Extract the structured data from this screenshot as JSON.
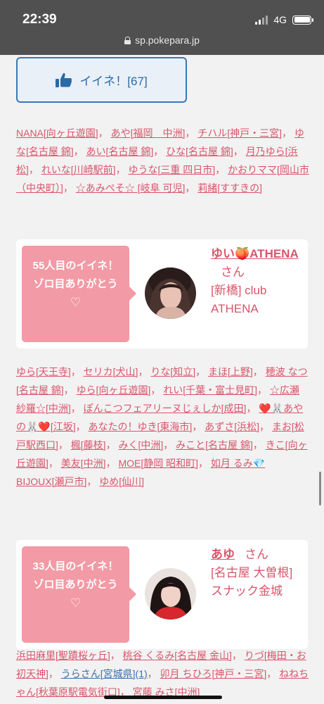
{
  "status_bar": {
    "time": "22:39",
    "network": "4G",
    "url": "sp.pokepara.jp"
  },
  "like_button": {
    "label": "イイネ！[67]"
  },
  "list1": [
    {
      "text": "NANA[向ヶ丘遊園]"
    },
    {
      "text": "あや[福岡　中洲]"
    },
    {
      "text": "チハル[神戸・三宮]"
    },
    {
      "text": "ゆな[名古屋 錦]"
    },
    {
      "text": "あい[名古屋 錦]"
    },
    {
      "text": "ひな[名古屋 錦]"
    },
    {
      "text": "月乃ゆら[浜松]"
    },
    {
      "text": "れいな[川崎駅前]"
    },
    {
      "text": "ゆうな[三重 四日市]"
    },
    {
      "text": "かおりママ[岡山市（中央町）]"
    },
    {
      "text": "☆あみぺそ☆ [岐阜 可児]"
    },
    {
      "text": "莉緒[すすきの]"
    }
  ],
  "card1": {
    "bubble_line1": "55人目のイイネ！",
    "bubble_line2": "ゾロ目ありがとう",
    "bubble_heart": "♡",
    "name": "ゆい🍑ATHENA",
    "san": "さん",
    "shop": "[新橋] club ATHENA"
  },
  "list2": [
    {
      "text": "ゆら[天王寺]"
    },
    {
      "text": "セリカ[犬山]"
    },
    {
      "text": "りな[知立]"
    },
    {
      "text": "まほ[上野]"
    },
    {
      "text": "穂波 なつ[名古屋 錦]"
    },
    {
      "text": "ゆら[向ヶ丘遊園]"
    },
    {
      "text": "れい[千葉・富士見町]"
    },
    {
      "text": "☆広瀬 紗羅☆[中洲]"
    },
    {
      "text": "ぽんこつフェアリーヌじぇしか[成田]"
    },
    {
      "text": "❤️🐰あやの🐰❤️[江坂]"
    },
    {
      "text": "あなたの！ゆき[東海市]"
    },
    {
      "text": "あずさ[浜松]"
    },
    {
      "text": "まお[松戸駅西口]"
    },
    {
      "text": "楓[藤枝]"
    },
    {
      "text": "みく[中洲]"
    },
    {
      "text": "みこと[名古屋 錦]"
    },
    {
      "text": "きこ[向ヶ丘遊園]"
    },
    {
      "text": "美友[中洲]"
    },
    {
      "text": "MOE[静岡 昭和町]"
    },
    {
      "text": "如月 るみ💎BIJOUX[瀬戸市]"
    },
    {
      "text": "ゆめ[仙川]"
    }
  ],
  "card2": {
    "bubble_line1": "33人目のイイネ！",
    "bubble_line2": "ゾロ目ありがとう",
    "bubble_heart": "♡",
    "name": "あゆ",
    "san": "さん",
    "shop": "[名古屋 大曽根] スナック金城"
  },
  "list3": [
    {
      "text": "浜田麻里[聖蹟桜ヶ丘]"
    },
    {
      "text": "桃谷 くるみ[名古屋 金山]"
    },
    {
      "text": "りづ[梅田・お初天神]"
    },
    {
      "text": "うらさん[宮城県](1)",
      "blue": true
    },
    {
      "text": "卯月 ちひろ[神戸・三宮]"
    },
    {
      "text": "ねねちゃん[秋葉原駅電気街口]"
    },
    {
      "text": "宮藤 みさ[中洲]"
    }
  ],
  "colors": {
    "accent_pink": "#d9556b",
    "bubble_pink": "#f29aa5",
    "link_blue": "#3a6fb0",
    "status_bar": "#505050"
  }
}
